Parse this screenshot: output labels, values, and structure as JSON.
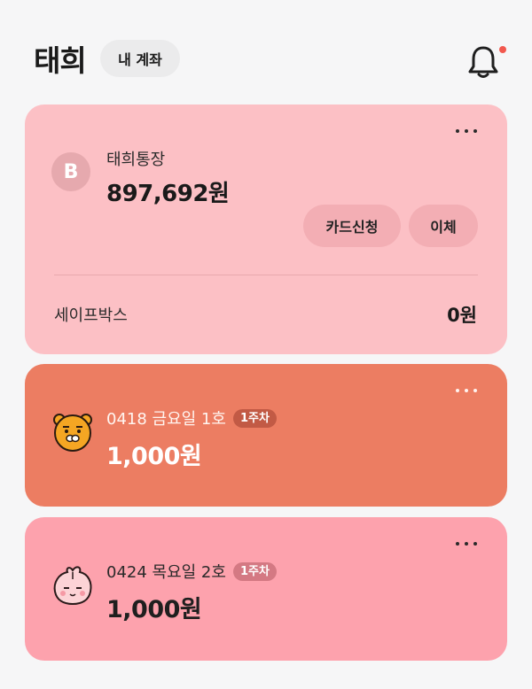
{
  "header": {
    "title": "태희",
    "account_pill": "내 계좌",
    "notification_dot_color": "#f2584e"
  },
  "main_account": {
    "logo": "B",
    "name": "태희통장",
    "balance": "897,692원",
    "buttons": {
      "card_apply": "카드신청",
      "transfer": "이체"
    },
    "safebox": {
      "label": "세이프박스",
      "amount": "0원"
    },
    "background_color": "#fcc0c5"
  },
  "savings": [
    {
      "title": "0418 금요일 1호",
      "badge": "1주차",
      "amount": "1,000원",
      "avatar_icon": "ryan-character-icon",
      "background_color": "#ec7d62"
    },
    {
      "title": "0424 목요일 2호",
      "badge": "1주차",
      "amount": "1,000원",
      "avatar_icon": "apeach-character-icon",
      "background_color": "#fda2ad"
    }
  ]
}
